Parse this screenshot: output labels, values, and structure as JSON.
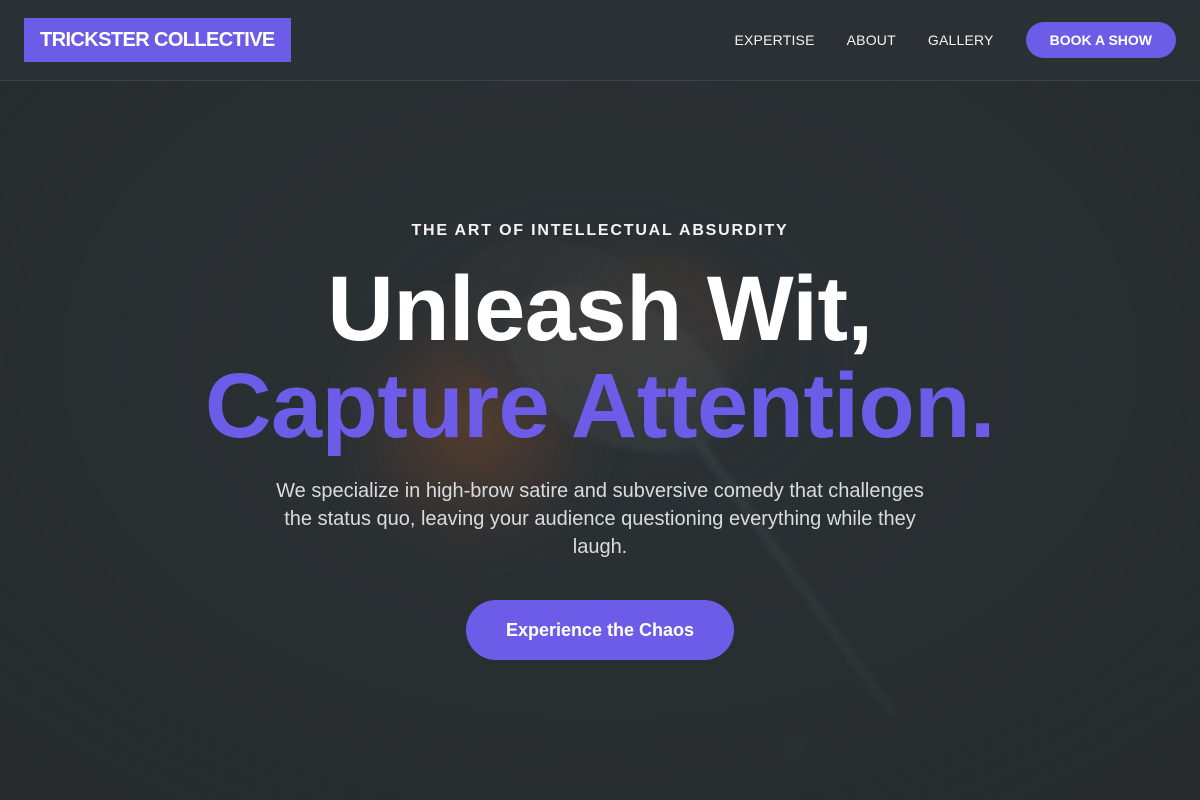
{
  "brand": {
    "name": "TRICKSTER COLLECTIVE",
    "accent_color": "#6c5ce7"
  },
  "nav": {
    "links": [
      "EXPERTISE",
      "ABOUT",
      "GALLERY"
    ],
    "cta_label": "BOOK A SHOW"
  },
  "hero": {
    "eyebrow": "THE ART OF INTELLECTUAL ABSURDITY",
    "title_line1": "Unleash Wit,",
    "title_line2": "Capture Attention.",
    "subtitle": "We specialize in high-brow satire and subversive comedy that challenges the status quo, leaving your audience questioning everything while they laugh.",
    "cta_label": "Experience the Chaos",
    "background_icon": "microphone-photo"
  }
}
